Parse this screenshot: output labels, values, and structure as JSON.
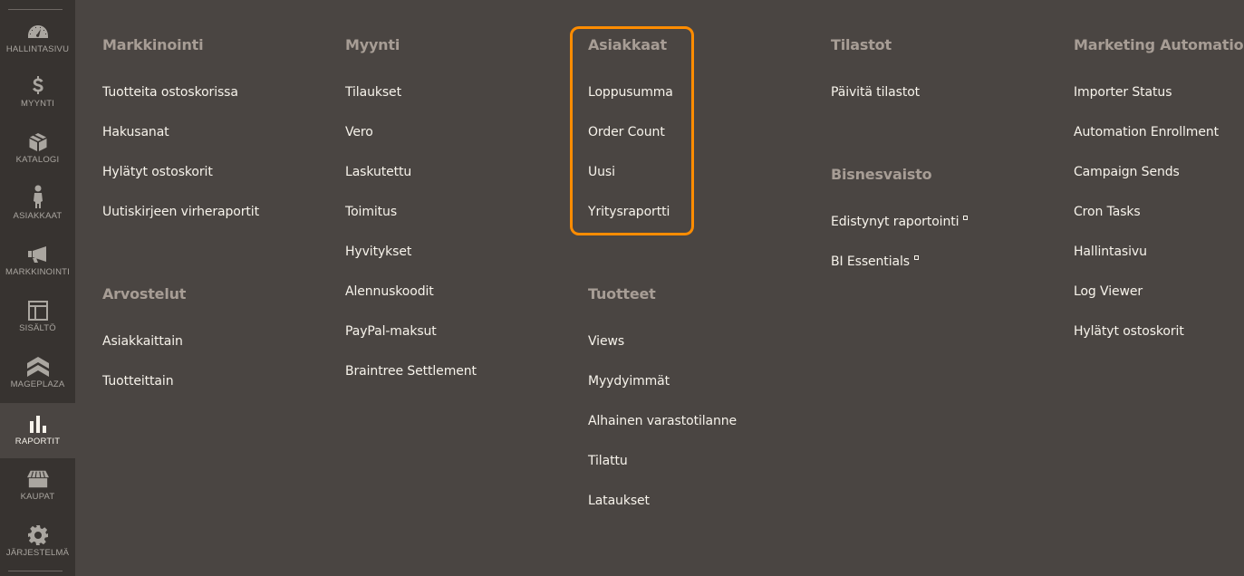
{
  "sidebar": {
    "items": [
      {
        "label": "Hallintasivu",
        "icon": "dashboard-icon",
        "active": false
      },
      {
        "label": "Myynti",
        "icon": "dollar-icon",
        "active": false
      },
      {
        "label": "Katalogi",
        "icon": "box-icon",
        "active": false
      },
      {
        "label": "Asiakkaat",
        "icon": "person-icon",
        "active": false
      },
      {
        "label": "Markkinointi",
        "icon": "megaphone-icon",
        "active": false
      },
      {
        "label": "Sisältö",
        "icon": "layout-icon",
        "active": false
      },
      {
        "label": "Mageplaza",
        "icon": "chevrons-up-icon",
        "active": false
      },
      {
        "label": "Raportit",
        "icon": "bar-chart-icon",
        "active": true
      },
      {
        "label": "Kaupat",
        "icon": "store-icon",
        "active": false
      },
      {
        "label": "Järjestelmä",
        "icon": "gear-icon",
        "active": false
      }
    ]
  },
  "menu": {
    "markkinointi": {
      "title": "Markkinointi",
      "items": [
        "Tuotteita ostoskorissa",
        "Hakusanat",
        "Hylätyt ostoskorit",
        "Uutiskirjeen virheraportit"
      ]
    },
    "arvostelut": {
      "title": "Arvostelut",
      "items": [
        "Asiakkaittain",
        "Tuotteittain"
      ]
    },
    "myynti": {
      "title": "Myynti",
      "items": [
        "Tilaukset",
        "Vero",
        "Laskutettu",
        "Toimitus",
        "Hyvitykset",
        "Alennuskoodit",
        "PayPal-maksut",
        "Braintree Settlement"
      ]
    },
    "asiakkaat": {
      "title": "Asiakkaat",
      "items": [
        "Loppusumma",
        "Order Count",
        "Uusi",
        "Yritysraportti"
      ]
    },
    "tuotteet": {
      "title": "Tuotteet",
      "items": [
        "Views",
        "Myydyimmät",
        "Alhainen varastotilanne",
        "Tilattu",
        "Lataukset"
      ]
    },
    "tilastot": {
      "title": "Tilastot",
      "items": [
        "Päivitä tilastot"
      ]
    },
    "bisnesvaisto": {
      "title": "Bisnesvaisto",
      "items": [
        "Edistynyt raportointi",
        "BI Essentials"
      ]
    },
    "marketing_automation": {
      "title": "Marketing Automation",
      "items": [
        "Importer Status",
        "Automation Enrollment",
        "Campaign Sends",
        "Cron Tasks",
        "Hallintasivu",
        "Log Viewer",
        "Hylätyt ostoskorit"
      ]
    }
  },
  "colors": {
    "highlight": "#ff8c00",
    "background": "#4a4542",
    "sidebar": "#373330"
  }
}
